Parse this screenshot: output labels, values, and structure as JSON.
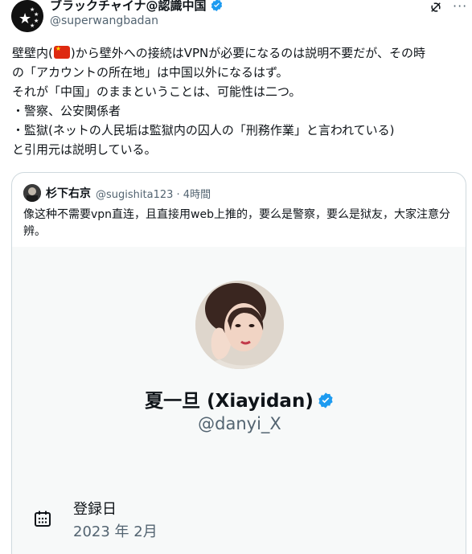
{
  "post": {
    "author_name": "ブラックチャイナ@認識中国",
    "author_handle": "@superwangbadan",
    "text_lines": [
      "壁内(",
      ")から壁外への接続はVPNが必要になるのは説明不要だが、その時",
      "の「アカウントの所在地」は中国以外になるはず。",
      "それが「中国」のままということは、可能性は二つ。",
      "・警察、公安関係者",
      "・監獄(ネットの人民垢は監獄内の囚人の「刑務作業」と言われている)",
      "と引用元は説明している。"
    ]
  },
  "quote": {
    "author_name": "杉下右京",
    "author_handle": "@sugishita123",
    "separator": " · ",
    "time": "4時間",
    "text": "像这种不需要vpn直连，且直接用web上推的，要么是警察，要么是狱友，大家注意分辨。",
    "card": {
      "display_name": "夏一旦 (Xiayidan)",
      "handle": "@danyi_X",
      "joined_label": "登録日",
      "joined_value": "2023 年 2月"
    }
  },
  "colors": {
    "verified_blue": "#1d9bf0",
    "secondary_text": "#536471",
    "border": "#cfd9de"
  },
  "icons": {
    "verified": "verified-badge-icon",
    "grok": "grok-icon",
    "more": "more-icon",
    "calendar": "calendar-icon"
  }
}
